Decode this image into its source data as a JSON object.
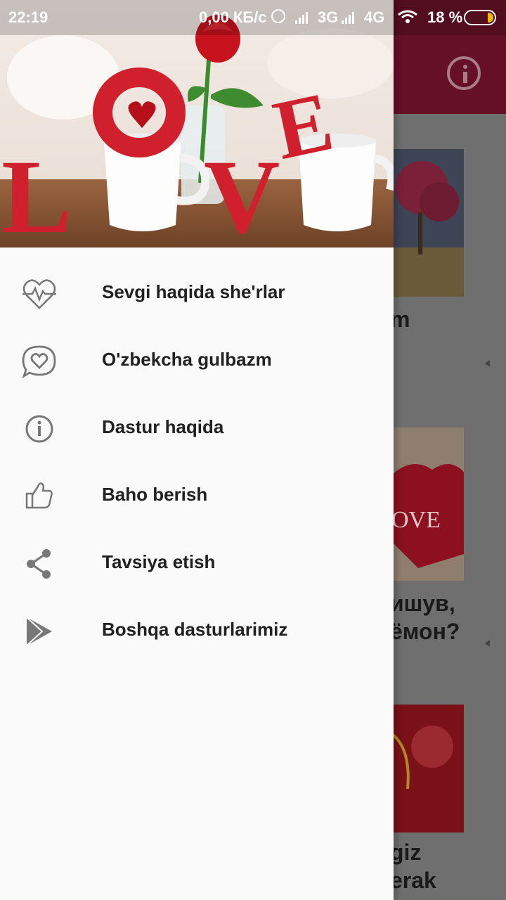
{
  "status_bar": {
    "time": "22:19",
    "network_speed": "0,00 КБ/с",
    "net_3g": "3G",
    "net_4g": "4G",
    "battery_percent": "18 %"
  },
  "header_image": {
    "letters": [
      "L",
      "O",
      "V",
      "E"
    ]
  },
  "drawer": {
    "items": [
      {
        "label": "Sevgi haqida she'rlar",
        "icon": "heartbeat-icon"
      },
      {
        "label": "O'zbekcha gulbazm",
        "icon": "heart-chat-icon"
      },
      {
        "label": "Dastur haqida",
        "icon": "info-icon"
      },
      {
        "label": "Baho berish",
        "icon": "thumbs-up-icon"
      },
      {
        "label": "Tavsiya etish",
        "icon": "share-icon"
      },
      {
        "label": "Boshqa dasturlarimiz",
        "icon": "play-store-icon"
      }
    ]
  },
  "background_list": {
    "card1_text": "m",
    "card2_text_line1": "ишув,",
    "card2_text_line2": "ёмон?",
    "card2_image_text": "OVE",
    "card3_text_line1": "giz",
    "card3_text_line2": "erak"
  },
  "colors": {
    "app_bar": "#651027",
    "accent_red": "#d0202e",
    "battery": "#f2b705"
  }
}
